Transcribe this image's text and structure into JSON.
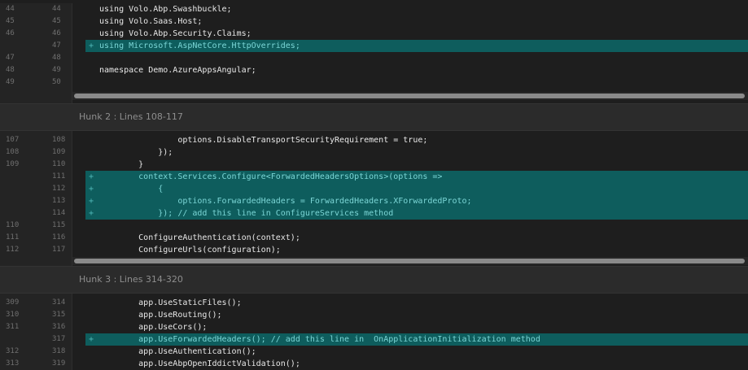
{
  "hunks": [
    {
      "header": "",
      "lines": [
        {
          "old": "44",
          "new": "44",
          "marker": "",
          "text": "using Volo.Abp.Swashbuckle;",
          "type": "context"
        },
        {
          "old": "45",
          "new": "45",
          "marker": "",
          "text": "using Volo.Saas.Host;",
          "type": "context"
        },
        {
          "old": "46",
          "new": "46",
          "marker": "",
          "text": "using Volo.Abp.Security.Claims;",
          "type": "context"
        },
        {
          "old": "",
          "new": "47",
          "marker": "+",
          "text": "using Microsoft.AspNetCore.HttpOverrides;",
          "type": "added"
        },
        {
          "old": "47",
          "new": "48",
          "marker": "",
          "text": "",
          "type": "context"
        },
        {
          "old": "48",
          "new": "49",
          "marker": "",
          "text": "namespace Demo.AzureAppsAngular;",
          "type": "context"
        },
        {
          "old": "49",
          "new": "50",
          "marker": "",
          "text": "",
          "type": "context"
        }
      ]
    },
    {
      "header": "Hunk 2 : Lines 108-117",
      "lines": [
        {
          "old": "107",
          "new": "108",
          "marker": "",
          "text": "                options.DisableTransportSecurityRequirement = true;",
          "type": "context"
        },
        {
          "old": "108",
          "new": "109",
          "marker": "",
          "text": "            });",
          "type": "context"
        },
        {
          "old": "109",
          "new": "110",
          "marker": "",
          "text": "        }",
          "type": "context"
        },
        {
          "old": "",
          "new": "111",
          "marker": "+",
          "text": "        context.Services.Configure<ForwardedHeadersOptions>(options =>",
          "type": "added"
        },
        {
          "old": "",
          "new": "112",
          "marker": "+",
          "text": "            {",
          "type": "added"
        },
        {
          "old": "",
          "new": "113",
          "marker": "+",
          "text": "                options.ForwardedHeaders = ForwardedHeaders.XForwardedProto;",
          "type": "added"
        },
        {
          "old": "",
          "new": "114",
          "marker": "+",
          "text": "            }); // add this line in ConfigureServices method",
          "type": "added"
        },
        {
          "old": "110",
          "new": "115",
          "marker": "",
          "text": "",
          "type": "context"
        },
        {
          "old": "111",
          "new": "116",
          "marker": "",
          "text": "        ConfigureAuthentication(context);",
          "type": "context"
        },
        {
          "old": "112",
          "new": "117",
          "marker": "",
          "text": "        ConfigureUrls(configuration);",
          "type": "context"
        }
      ]
    },
    {
      "header": "Hunk 3 : Lines 314-320",
      "lines": [
        {
          "old": "309",
          "new": "314",
          "marker": "",
          "text": "        app.UseStaticFiles();",
          "type": "context"
        },
        {
          "old": "310",
          "new": "315",
          "marker": "",
          "text": "        app.UseRouting();",
          "type": "context"
        },
        {
          "old": "311",
          "new": "316",
          "marker": "",
          "text": "        app.UseCors();",
          "type": "context"
        },
        {
          "old": "",
          "new": "317",
          "marker": "+",
          "text": "        app.UseForwardedHeaders(); // add this line in  OnApplicationInitialization method",
          "type": "added"
        },
        {
          "old": "312",
          "new": "318",
          "marker": "",
          "text": "        app.UseAuthentication();",
          "type": "context"
        },
        {
          "old": "313",
          "new": "319",
          "marker": "",
          "text": "        app.UseAbpOpenIddictValidation();",
          "type": "context"
        }
      ]
    }
  ],
  "colors": {
    "background": "#1e1e1e",
    "added_background": "#0e5d5d",
    "added_text": "#7bd6d6",
    "gutter": "#242424",
    "line_number": "#6f6f6f"
  }
}
